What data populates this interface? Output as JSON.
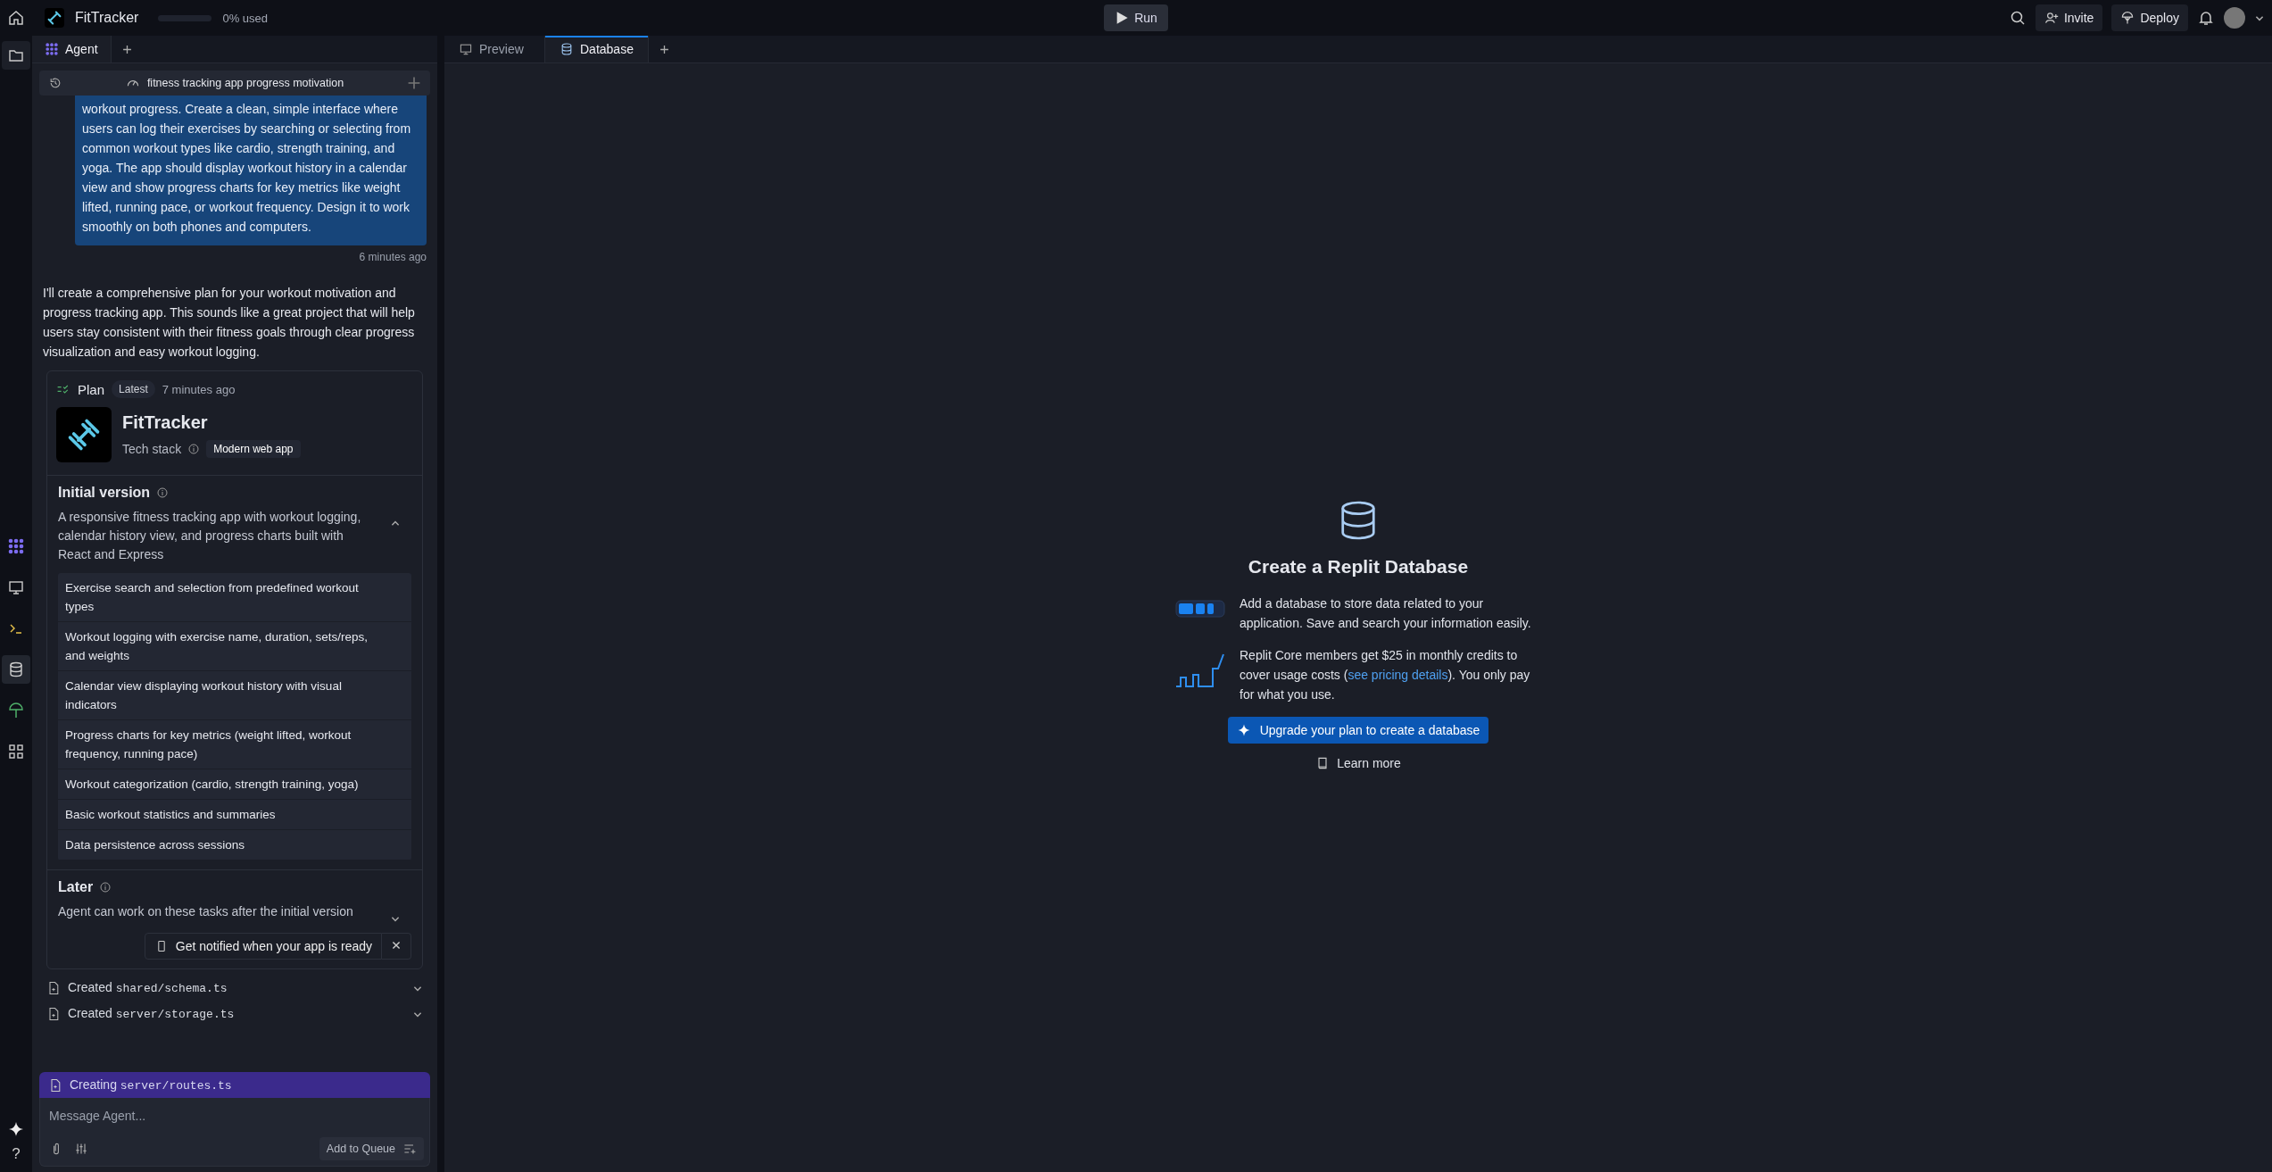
{
  "topbar": {
    "project": "FitTracker",
    "usage": {
      "level": 0,
      "reading": "0% used"
    },
    "run_label": "Run",
    "invite_label": "Invite",
    "deploy_label": "Deploy"
  },
  "rail": {
    "items": [
      {
        "kind": "agent",
        "selected": false
      },
      {
        "kind": "preview",
        "selected": false
      },
      {
        "kind": "console",
        "selected": false
      },
      {
        "kind": "database",
        "selected": true
      },
      {
        "kind": "deploy",
        "selected": false
      },
      {
        "kind": "apps",
        "selected": false
      }
    ],
    "help_label": "?"
  },
  "agent_panel": {
    "tabs": [
      {
        "label": "Agent",
        "selected": true
      }
    ],
    "chat_title": "fitness tracking app progress motivation",
    "user_message": {
      "text": "workout progress. Create a clean, simple interface where users can log their exercises by searching or selecting from common workout types like cardio, strength training, and yoga. The app should display workout history in a calendar view and show progress charts for key metrics like weight lifted, running pace, or workout frequency. Design it to work smoothly on both phones and computers.",
      "time": "6 minutes ago"
    },
    "agent_message": "I'll create a comprehensive plan for your workout motivation and progress tracking app. This sounds like a great project that will help users stay consistent with their fitness goals through clear progress visualization and easy workout logging.",
    "plan": {
      "label": "Plan",
      "badge": "Latest",
      "time": "7 minutes ago",
      "app_name": "FitTracker",
      "tech_stack_label": "Tech stack",
      "tech_stack": "Modern web app",
      "initial": {
        "title": "Initial version",
        "description": "A responsive fitness tracking app with workout logging, calendar history view, and progress charts built with React and Express",
        "expanded": true,
        "features": [
          "Exercise search and selection from predefined workout types",
          "Workout logging with exercise name, duration, sets/reps, and weights",
          "Calendar view displaying workout history with visual indicators",
          "Progress charts for key metrics (weight lifted, workout frequency, running pace)",
          "Workout categorization (cardio, strength training, yoga)",
          "Basic workout statistics and summaries",
          "Data persistence across sessions"
        ]
      },
      "later": {
        "title": "Later",
        "description": "Agent can work on these tasks after the initial version",
        "expanded": false
      },
      "notify_label": "Get notified when your app is ready"
    },
    "files": [
      {
        "verb": "Created",
        "path": "shared/schema.ts"
      },
      {
        "verb": "Created",
        "path": "server/storage.ts"
      }
    ],
    "progress": {
      "verb": "Creating",
      "path": "server/routes.ts"
    },
    "input": {
      "placeholder": "Message Agent...",
      "queue_label": "Add to Queue"
    }
  },
  "main_panel": {
    "tabs": [
      {
        "label": "Preview",
        "kind": "preview",
        "selected": false
      },
      {
        "label": "Database",
        "kind": "database",
        "selected": true
      }
    ],
    "title": "Create a Replit Database",
    "info": [
      {
        "kind": "storage",
        "text": "Add a database to store data related to your application. Save and search your information easily."
      },
      {
        "kind": "usage",
        "text": "Replit Core members get $25 in monthly credits to cover usage costs (",
        "link": "see pricing details",
        "after": "). You only pay for what you use."
      }
    ],
    "upgrade_label": "Upgrade your plan to create a database",
    "learn_label": "Learn more"
  }
}
